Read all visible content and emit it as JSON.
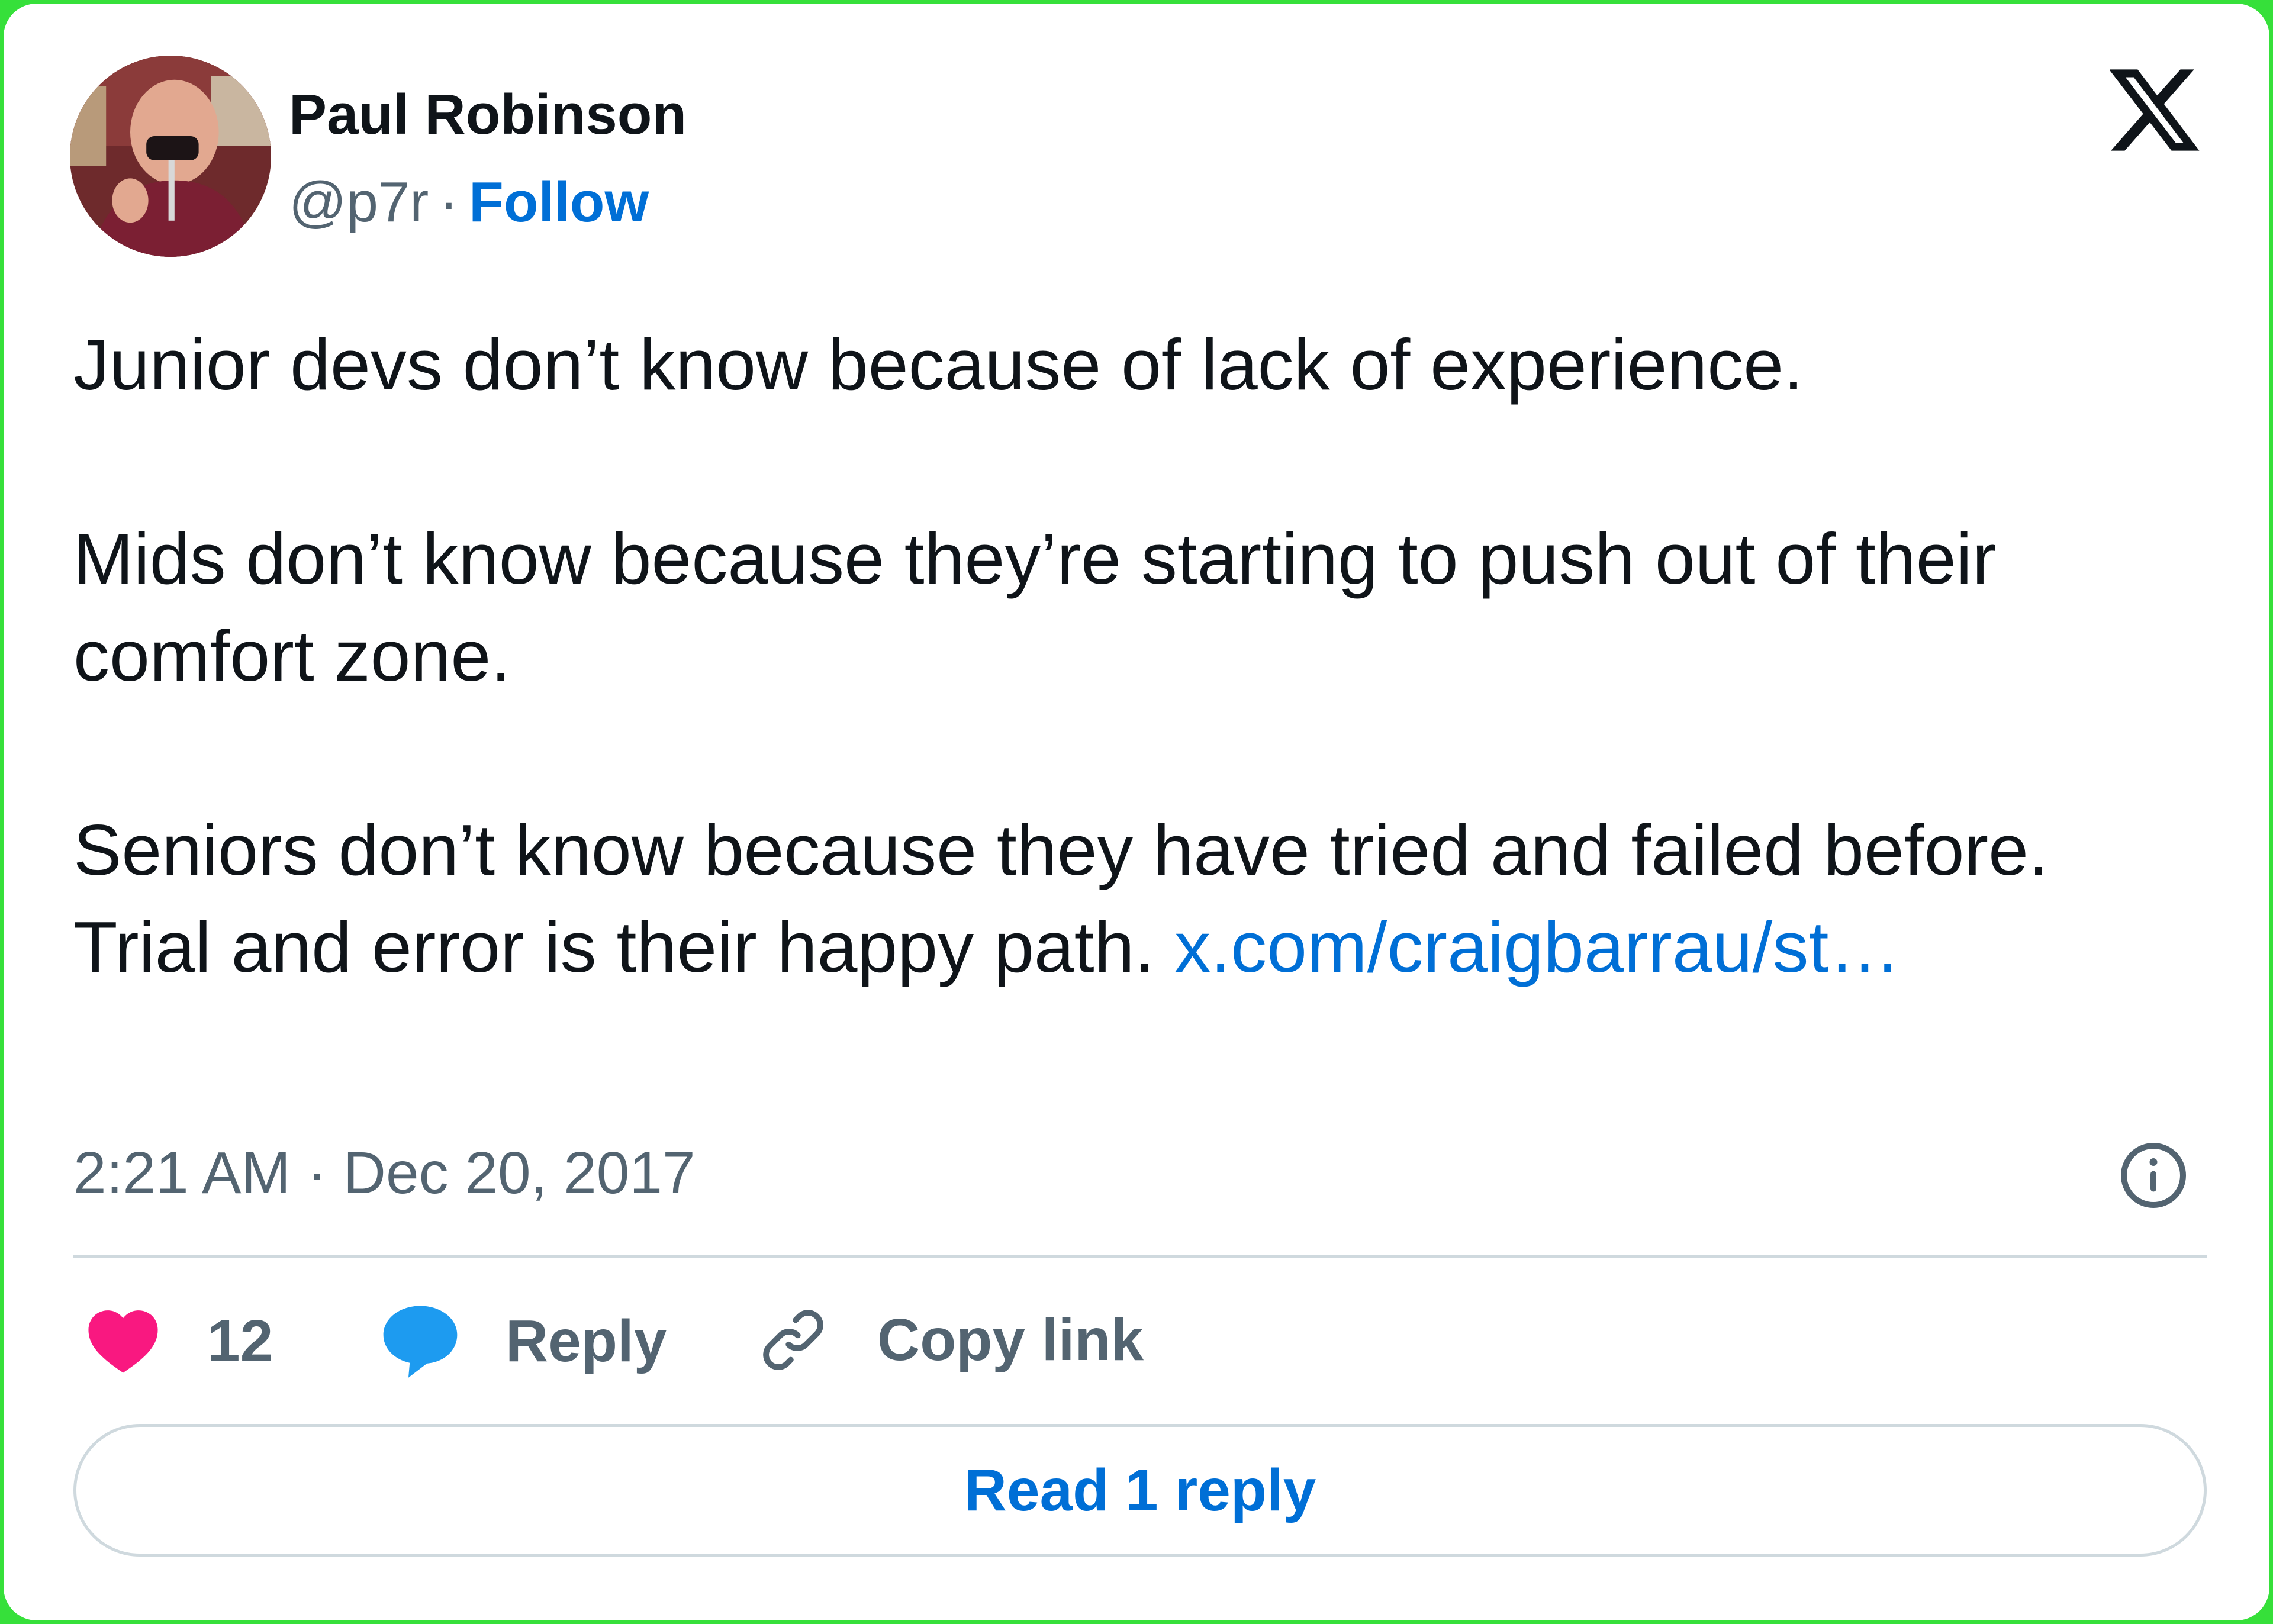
{
  "author": {
    "name": "Paul Robinson",
    "handle": "@p7r",
    "separator": "·",
    "follow_label": "Follow",
    "avatar_icon": "profile-photo"
  },
  "platform": {
    "logo_icon": "x-logo"
  },
  "tweet": {
    "paragraphs": [
      "Junior devs don’t know because of lack of experience.",
      "Mids don’t know because they’re starting to push out of their comfort zone.",
      "Seniors don’t know because they have tried and failed before. Trial and error is their happy path. "
    ],
    "link_text": "x.com/​craigbarrau/st…",
    "timestamp": "2:21 AM · Dec 20, 2017"
  },
  "actions": {
    "like_count": "12",
    "reply_label": "Reply",
    "copy_label": "Copy link"
  },
  "read_replies_label": "Read 1 reply",
  "colors": {
    "link": "#006fd6",
    "like": "#f91880",
    "reply": "#1d9bf0",
    "muted": "#536471",
    "text": "#0f1419",
    "frame": "#36e03a"
  }
}
